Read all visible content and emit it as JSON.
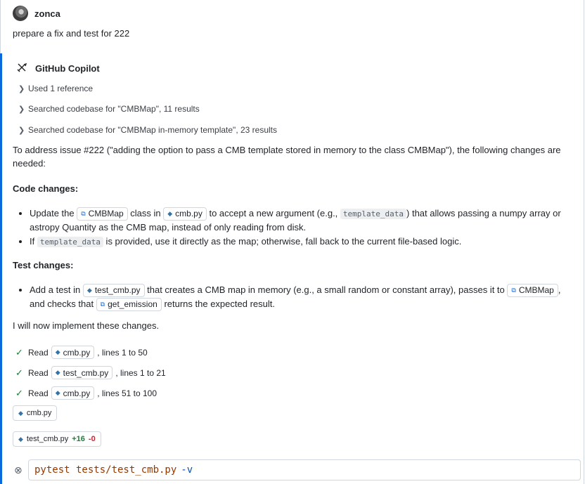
{
  "user": {
    "name": "zonca",
    "message": "prepare a fix and test for 222"
  },
  "assistant": {
    "name": "GitHub Copilot"
  },
  "references": [
    "Used 1 reference",
    "Searched codebase for \"CMBMap\", 11 results",
    "Searched codebase for \"CMBMap in-memory template\", 23 results"
  ],
  "intro": "To address issue #222 (\"adding the option to pass a CMB template stored in memory to the class CMBMap\"), the following changes are needed:",
  "code_changes": {
    "heading": "Code changes:",
    "b1": {
      "p1": "Update the ",
      "chip1": "CMBMap",
      "p2": " class in ",
      "chip2": "cmb.py",
      "p3": " to accept a new argument (e.g., ",
      "code": "template_data",
      "p4": ") that allows passing a numpy array or astropy Quantity as the CMB map, instead of only reading from disk."
    },
    "b2": {
      "p1": "If ",
      "code": "template_data",
      "p2": " is provided, use it directly as the map; otherwise, fall back to the current file-based logic."
    }
  },
  "test_changes": {
    "heading": "Test changes:",
    "b1": {
      "p1": "Add a test in ",
      "chip1": "test_cmb.py",
      "p2": " that creates a CMB map in memory (e.g., a small random or constant array), passes it to ",
      "chip2": "CMBMap",
      "p3": ", and checks that ",
      "chip3": "get_emission",
      "p4": " returns the expected result."
    }
  },
  "implement": "I will now implement these changes.",
  "steps": [
    {
      "action": "Read",
      "file": "cmb.py",
      "suffix": ", lines 1 to 50"
    },
    {
      "action": "Read",
      "file": "test_cmb.py",
      "suffix": ", lines 1 to 21"
    },
    {
      "action": "Read",
      "file": "cmb.py",
      "suffix": ", lines 51 to 100"
    }
  ],
  "edited_files": [
    {
      "name": "cmb.py"
    },
    {
      "name": "test_cmb.py",
      "added": "+16",
      "removed": "-0"
    }
  ],
  "terminal": {
    "command": "pytest tests/test_cmb.py",
    "flag": "-v"
  }
}
